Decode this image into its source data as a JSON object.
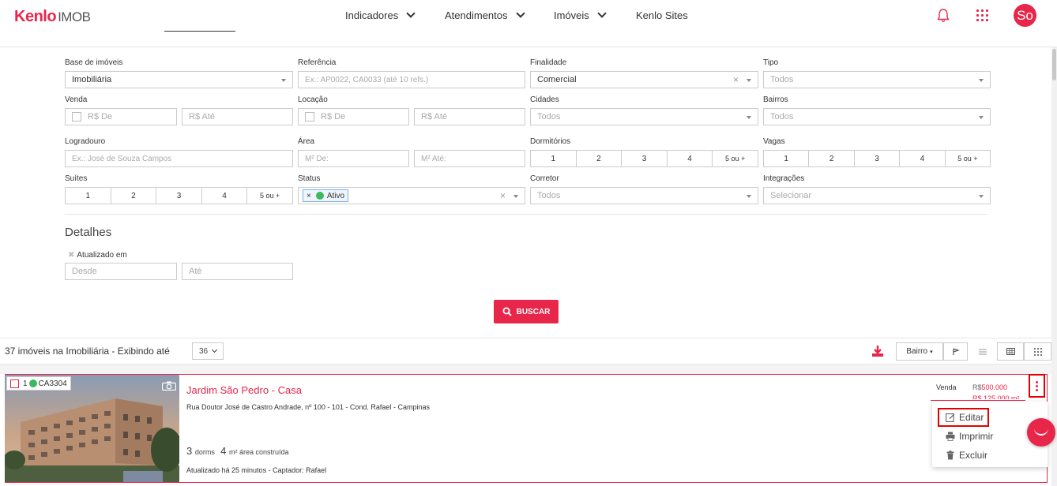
{
  "header": {
    "logo_kenlo": "Kenlo",
    "logo_imob": "IMOB",
    "nav": [
      "Indicadores",
      "Atendimentos",
      "Imóveis",
      "Kenlo Sites"
    ],
    "avatar": "So"
  },
  "filters": {
    "base": {
      "label": "Base de imóveis",
      "value": "Imobiliária"
    },
    "referencia": {
      "label": "Referência",
      "placeholder": "Ex.: AP0022, CA0033 (até 10 refs.)"
    },
    "finalidade": {
      "label": "Finalidade",
      "value": "Comercial"
    },
    "tipo": {
      "label": "Tipo",
      "placeholder": "Todos"
    },
    "venda": {
      "label": "Venda",
      "de": "R$ De",
      "ate": "R$ Até"
    },
    "locacao": {
      "label": "Locação",
      "de": "R$ De",
      "ate": "R$ Até"
    },
    "cidades": {
      "label": "Cidades",
      "placeholder": "Todos"
    },
    "bairros": {
      "label": "Bairros",
      "placeholder": "Todos"
    },
    "logradouro": {
      "label": "Logradouro",
      "placeholder": "Ex.: José de Souza Campos"
    },
    "area": {
      "label": "Área",
      "de": "M² De:",
      "ate": "M² Até:"
    },
    "dormitorios": {
      "label": "Dormitórios",
      "options": [
        "1",
        "2",
        "3",
        "4",
        "5 ou +"
      ]
    },
    "vagas": {
      "label": "Vagas",
      "options": [
        "1",
        "2",
        "3",
        "4",
        "5 ou +"
      ]
    },
    "suites": {
      "label": "Suítes",
      "options": [
        "1",
        "2",
        "3",
        "4",
        "5 ou +"
      ]
    },
    "status": {
      "label": "Status",
      "tag_x": "×",
      "tag": "Ativo"
    },
    "corretor": {
      "label": "Corretor",
      "placeholder": "Todos"
    },
    "integracoes": {
      "label": "Integrações",
      "placeholder": "Selecionar"
    },
    "clear_x": "×"
  },
  "detalhes": {
    "title": "Detalhes",
    "atualizado_label": "Atualizado em",
    "desde": "Desde",
    "ate": "Até"
  },
  "buscar_label": "BUSCAR",
  "results": {
    "count_text": "37 imóveis na Imobiliária - Exibindo até",
    "per_page": "36",
    "sort_label": "Bairro"
  },
  "property": {
    "index": "1",
    "code": "CA3304",
    "title": "Jardim São Pedro - Casa",
    "address": "Rua Doutor José de Castro Andrade, nº 100 - 101 - Cond. Rafael - Campinas",
    "dorms_num": "3",
    "dorms_label": "dorms",
    "area_num": "4",
    "area_label": "m² área construída",
    "updated": "Atualizado há 25 minutos - Captador: Rafael",
    "price_type": "Venda",
    "price_currency": "R$",
    "price_value": "500.000",
    "price_second": "R$ 125.000 m²"
  },
  "menu": {
    "edit": "Editar",
    "print": "Imprimir",
    "delete": "Excluir"
  },
  "colors": {
    "accent": "#e8264a",
    "status_green": "#3cb95f",
    "highlight": "#e40000"
  }
}
